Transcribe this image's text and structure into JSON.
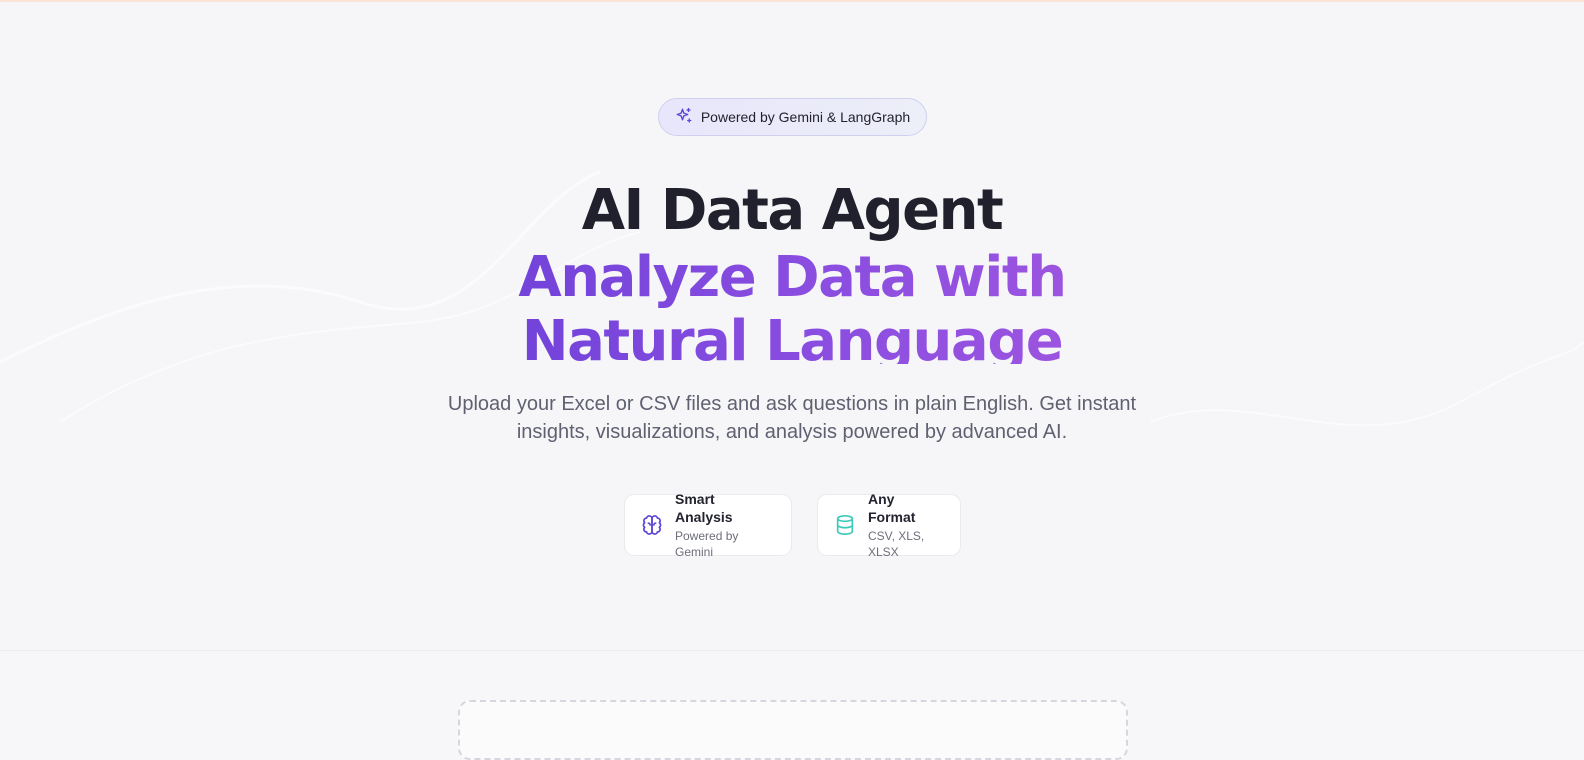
{
  "badge": {
    "icon": "sparkles-icon",
    "label": "Powered by Gemini & LangGraph"
  },
  "hero": {
    "title": "AI Data Agent",
    "subtitle": "Analyze Data with Natural Language",
    "description": "Upload your Excel or CSV files and ask questions in plain English. Get instant insights, visualizations, and analysis powered by advanced AI."
  },
  "features": [
    {
      "icon": "brain-icon",
      "title": "Smart Analysis",
      "subtitle": "Powered by Gemini"
    },
    {
      "icon": "database-icon",
      "title": "Any Format",
      "subtitle": "CSV, XLS, XLSX"
    }
  ],
  "colors": {
    "accent_purple": "#6a3fd8",
    "accent_violet": "#a457df",
    "teal_icon": "#3cc9b9",
    "background": "#f6f6f9"
  }
}
